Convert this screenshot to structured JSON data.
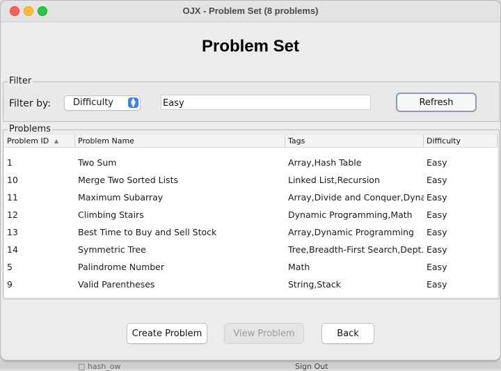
{
  "window": {
    "title": "OJX - Problem Set (8 problems)"
  },
  "heading": "Problem Set",
  "filter": {
    "legend": "Filter",
    "label": "Filter by:",
    "selected": "Difficulty",
    "value": "Easy",
    "refresh_label": "Refresh"
  },
  "problems": {
    "legend": "Problems",
    "columns": [
      "Problem ID",
      "Problem Name",
      "Tags",
      "Difficulty"
    ],
    "sort_column": "Problem ID",
    "sort_direction": "ascending",
    "rows": [
      [
        "1",
        "Two Sum",
        "Array,Hash Table",
        "Easy"
      ],
      [
        "10",
        "Merge Two Sorted Lists",
        "Linked List,Recursion",
        "Easy"
      ],
      [
        "11",
        "Maximum Subarray",
        "Array,Divide and Conquer,Dyna...",
        "Easy"
      ],
      [
        "12",
        "Climbing Stairs",
        "Dynamic Programming,Math",
        "Easy"
      ],
      [
        "13",
        "Best Time to Buy and Sell Stock",
        "Array,Dynamic Programming",
        "Easy"
      ],
      [
        "14",
        "Symmetric Tree",
        "Tree,Breadth-First Search,Dept...",
        "Easy"
      ],
      [
        "5",
        "Palindrome Number",
        "Math",
        "Easy"
      ],
      [
        "9",
        "Valid Parentheses",
        "String,Stack",
        "Easy"
      ]
    ]
  },
  "buttons": {
    "create": "Create Problem",
    "view": "View Problem",
    "back": "Back"
  },
  "background_window": {
    "text_left": "□ hash_ow",
    "text_right": "Sign Out"
  },
  "colors": {
    "accent": "#3b82f6",
    "close": "#fe5f57",
    "minimize": "#febc2e",
    "maximize": "#28c840"
  }
}
